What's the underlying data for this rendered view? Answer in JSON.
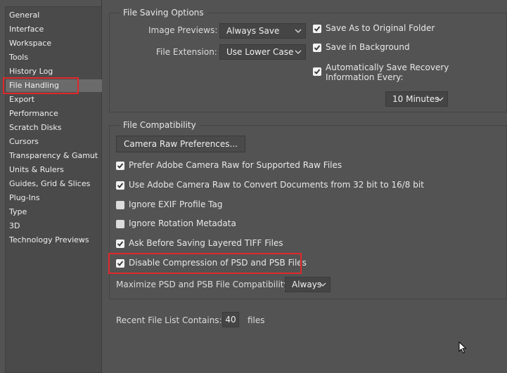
{
  "sidebar": {
    "items": [
      {
        "label": "General"
      },
      {
        "label": "Interface"
      },
      {
        "label": "Workspace"
      },
      {
        "label": "Tools"
      },
      {
        "label": "History Log"
      },
      {
        "label": "File Handling",
        "selected": true
      },
      {
        "label": "Export"
      },
      {
        "label": "Performance"
      },
      {
        "label": "Scratch Disks"
      },
      {
        "label": "Cursors"
      },
      {
        "label": "Transparency & Gamut"
      },
      {
        "label": "Units & Rulers"
      },
      {
        "label": "Guides, Grid & Slices"
      },
      {
        "label": "Plug-Ins"
      },
      {
        "label": "Type"
      },
      {
        "label": "3D"
      },
      {
        "label": "Technology Previews"
      }
    ]
  },
  "file_saving": {
    "title": "File Saving Options",
    "image_previews_label": "Image Previews:",
    "image_previews_value": "Always Save",
    "file_extension_label": "File Extension:",
    "file_extension_value": "Use Lower Case",
    "save_as_original": {
      "label": "Save As to Original Folder",
      "checked": true
    },
    "save_in_background": {
      "label": "Save in Background",
      "checked": true
    },
    "auto_save_line1": "Automatically Save Recovery",
    "auto_save_line2": "Information Every:",
    "auto_save_checked": true,
    "auto_save_interval": "10 Minutes"
  },
  "file_compat": {
    "title": "File Compatibility",
    "camera_raw_button": "Camera Raw Preferences...",
    "options": [
      {
        "label": "Prefer Adobe Camera Raw for Supported Raw Files",
        "checked": true
      },
      {
        "label": "Use Adobe Camera Raw to Convert Documents from 32 bit to 16/8 bit",
        "checked": true
      },
      {
        "label": "Ignore EXIF Profile Tag",
        "checked": false
      },
      {
        "label": "Ignore Rotation Metadata",
        "checked": false
      },
      {
        "label": "Ask Before Saving Layered TIFF Files",
        "checked": true
      },
      {
        "label": "Disable Compression of PSD and PSB Files",
        "checked": true
      }
    ],
    "maximize_label": "Maximize PSD and PSB File Compatibility:",
    "maximize_value": "Always"
  },
  "recent_files": {
    "label": "Recent File List Contains:",
    "value": "40",
    "suffix": "files"
  },
  "colors": {
    "background": "#535353",
    "highlight_box": "#e0282c",
    "selected_item": "#6b6b6b"
  }
}
